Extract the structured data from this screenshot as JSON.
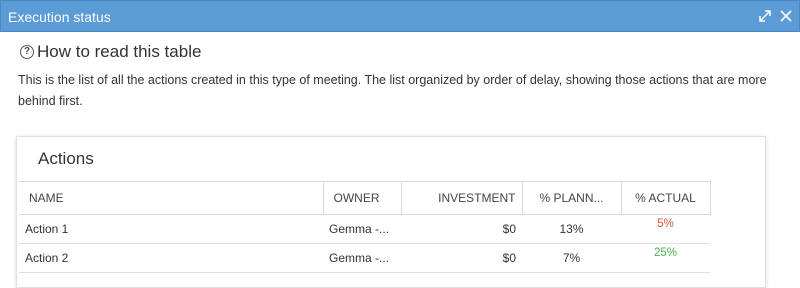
{
  "window": {
    "title": "Execution status",
    "icons": [
      "expand-icon",
      "close-icon"
    ]
  },
  "help": {
    "icon": "question-circle-icon",
    "title": "How to read this table",
    "description": "This is the list of all the actions created in this type of meeting. The list organized by order of delay, showing those actions that are more behind first."
  },
  "actions_panel": {
    "title": "Actions",
    "columns": [
      "NAME",
      "OWNER",
      "INVESTMENT",
      "% PLANN...",
      "% ACTUAL"
    ],
    "rows": [
      {
        "name": "Action 1",
        "owner": "Gemma -...",
        "investment": "$0",
        "planned": "13%",
        "actual": "5%",
        "actual_color": "#e0503a"
      },
      {
        "name": "Action 2",
        "owner": "Gemma -...",
        "investment": "$0",
        "planned": "7%",
        "actual": "25%",
        "actual_color": "#4caf50"
      }
    ]
  }
}
